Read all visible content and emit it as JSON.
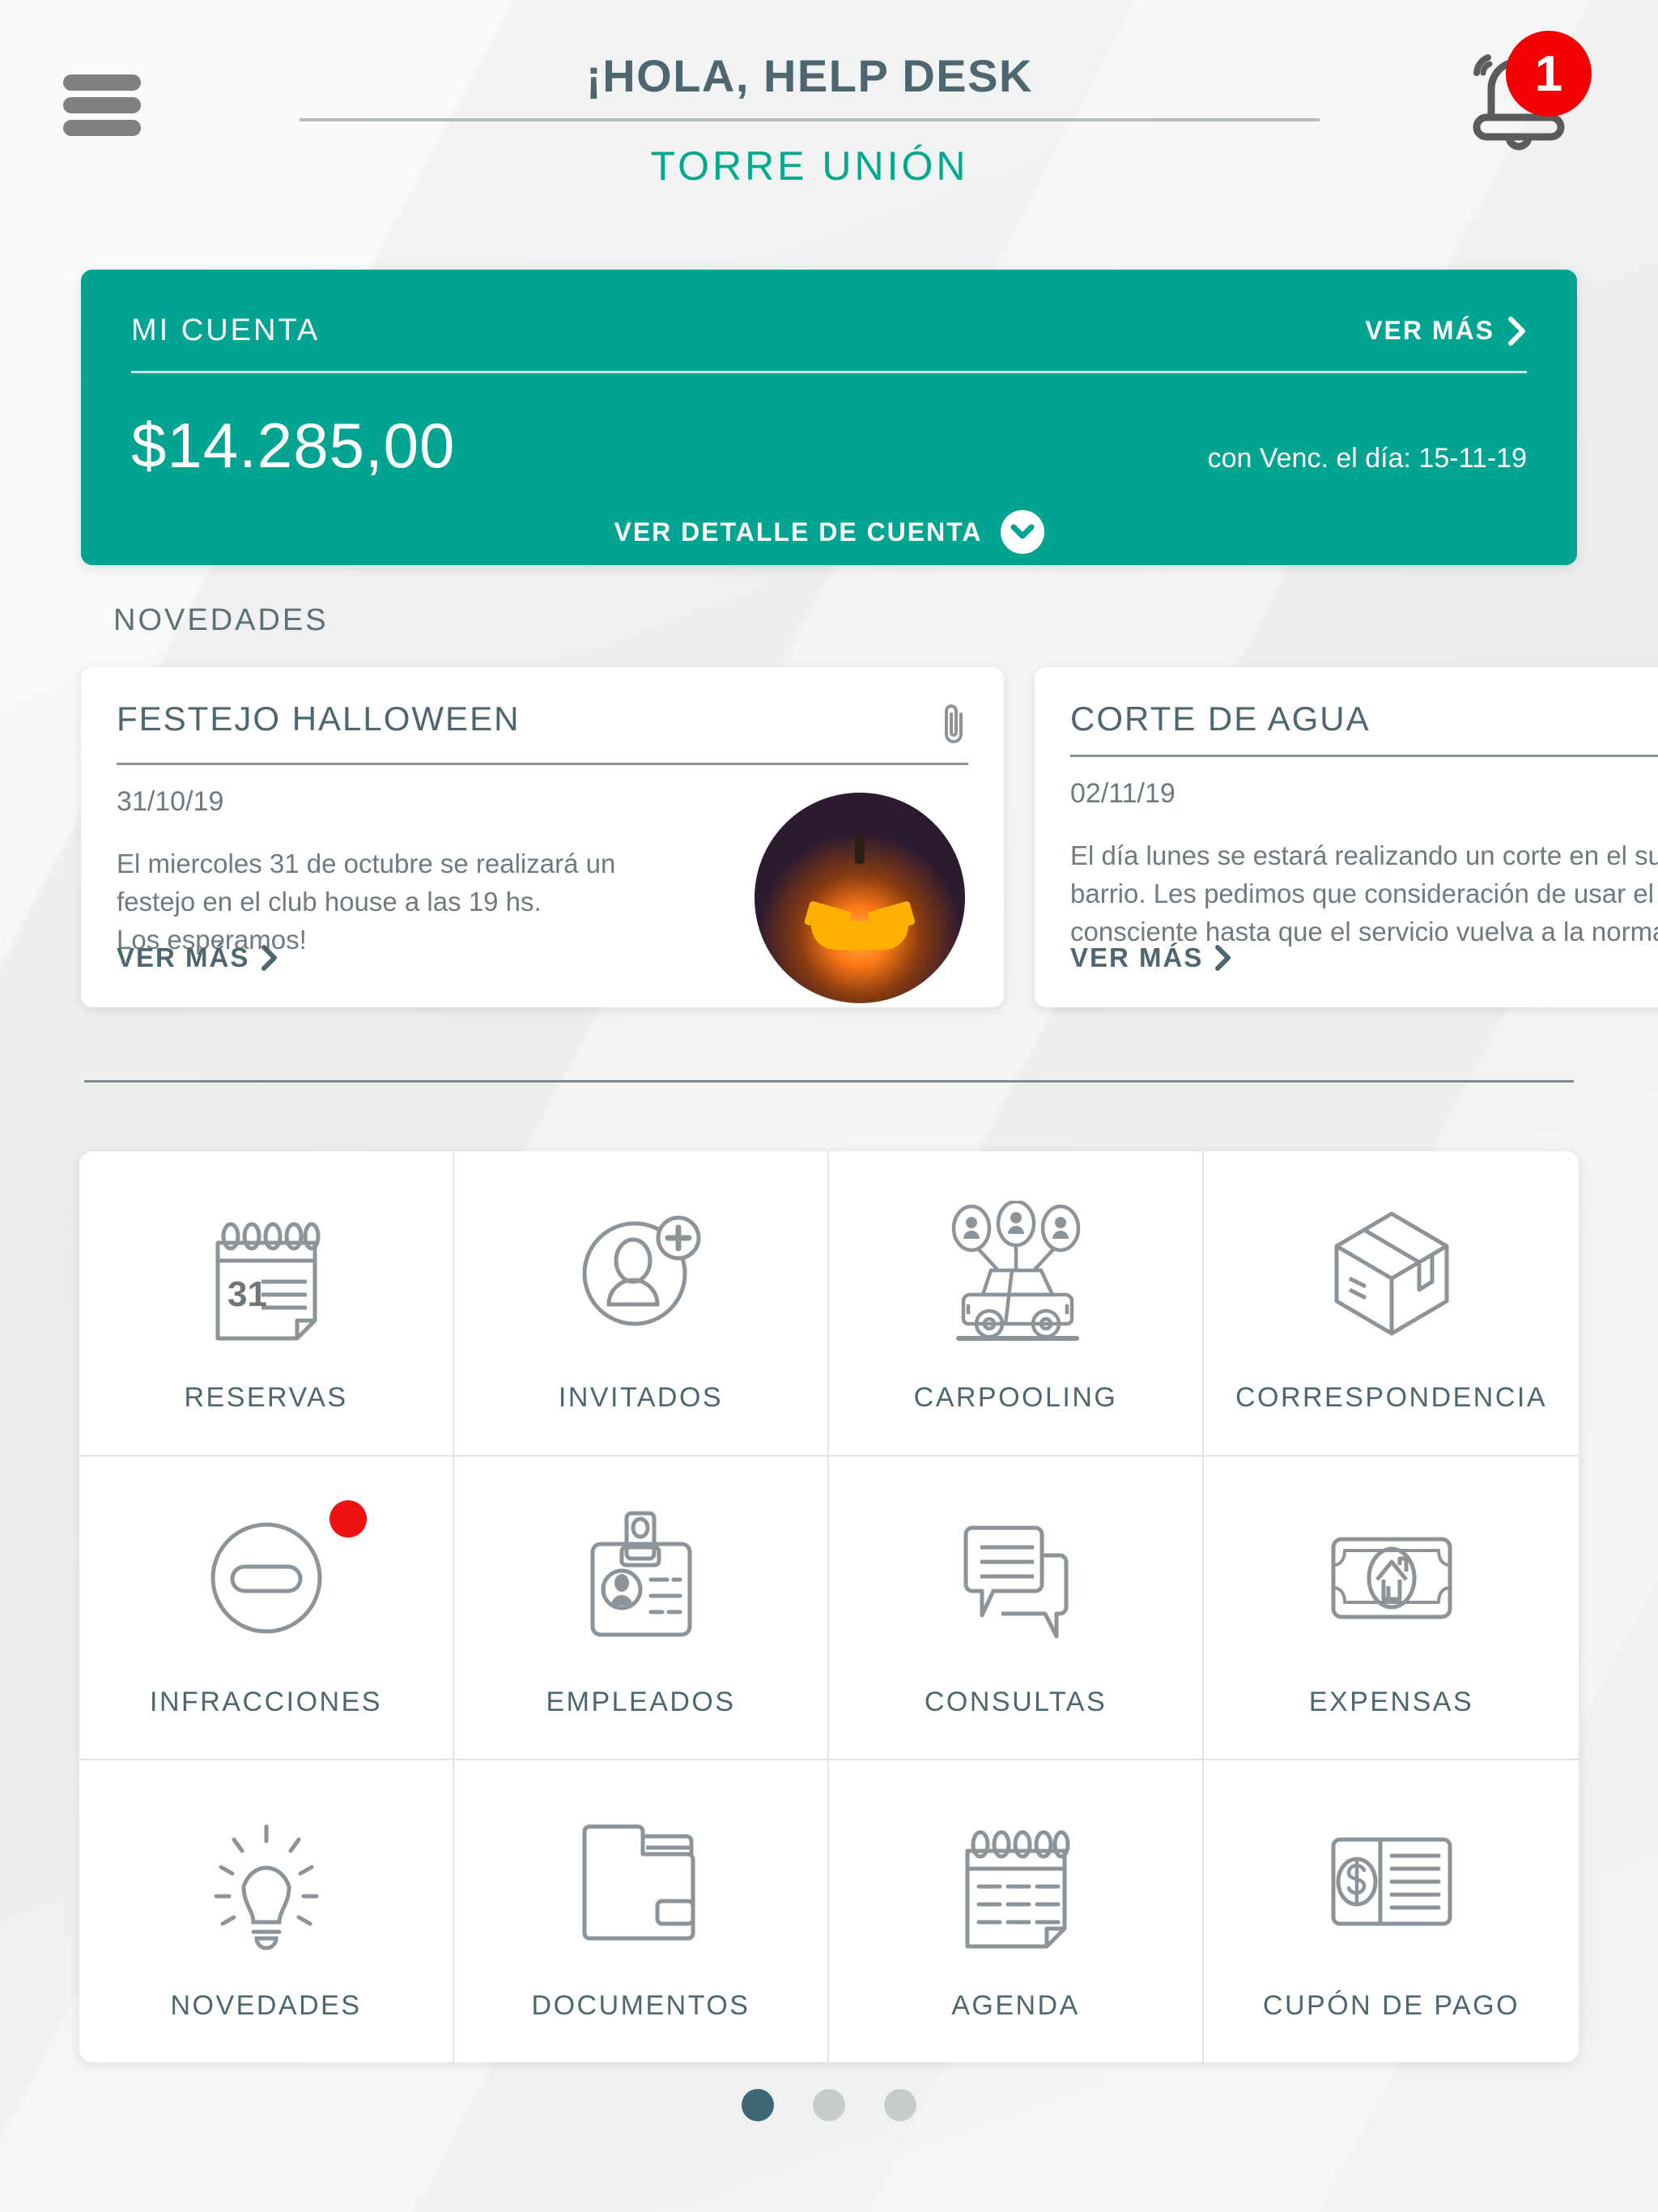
{
  "header": {
    "menu_icon": "hamburger-menu-icon",
    "title": "¡HOLA, HELP DESK",
    "subtitle": "TORRE UNIÓN",
    "notification": {
      "icon": "bell-icon",
      "count": "1",
      "badge_color": "#f40000"
    }
  },
  "account_card": {
    "label": "MI CUENTA",
    "see_more": "VER MÁS",
    "amount": "$14.285,00",
    "due": "con Venc. el día: 15-11-19",
    "detail_link": "VER DETALLE DE CUENTA",
    "chevron_icon": "chevron-down-icon",
    "bg_color": "#00a491"
  },
  "news": {
    "section_title": "NOVEDADES",
    "items": [
      {
        "title": "FESTEJO HALLOWEEN",
        "date": "31/10/19",
        "body": "El miercoles 31 de octubre se realizará un festejo en el club house a las 19 hs.\nLos esperamos!",
        "see_more": "VER MÁS",
        "attachment_icon": "paperclip-icon",
        "has_thumbnail": true
      },
      {
        "title": "CORTE DE AGUA",
        "date": "02/11/19",
        "body": "El día lunes se estará realizando un corte en el suministro de agua del barrio. Les pedimos que consideración de usar el agua de forma consciente hasta que el servicio vuelva a la normalidad.",
        "see_more": "VER MÁS",
        "attachment_icon": null,
        "has_thumbnail": false
      }
    ]
  },
  "menu_grid": {
    "items": [
      {
        "label": "RESERVAS",
        "icon": "calendar-31-icon",
        "badge": false
      },
      {
        "label": "INVITADOS",
        "icon": "user-plus-icon",
        "badge": false
      },
      {
        "label": "CARPOOLING",
        "icon": "carpool-car-icon",
        "badge": false
      },
      {
        "label": "CORRESPONDENCIA",
        "icon": "package-box-icon",
        "badge": false
      },
      {
        "label": "INFRACCIONES",
        "icon": "no-entry-icon",
        "badge": true
      },
      {
        "label": "EMPLEADOS",
        "icon": "id-badge-icon",
        "badge": false
      },
      {
        "label": "CONSULTAS",
        "icon": "chat-bubbles-icon",
        "badge": false
      },
      {
        "label": "EXPENSAS",
        "icon": "banknote-house-icon",
        "badge": false
      },
      {
        "label": "NOVEDADES",
        "icon": "lightbulb-icon",
        "badge": false
      },
      {
        "label": "DOCUMENTOS",
        "icon": "folder-icon",
        "badge": false
      },
      {
        "label": "AGENDA",
        "icon": "calendar-grid-icon",
        "badge": false
      },
      {
        "label": "CUPÓN DE PAGO",
        "icon": "payment-coupon-icon",
        "badge": false
      }
    ]
  },
  "pagination": {
    "total": 3,
    "active_index": 0,
    "active_color": "#3d6676",
    "inactive_color": "#c7cbcb"
  },
  "theme": {
    "accent_teal": "#00a491",
    "title_slate": "#4e6670",
    "subtitle_green": "#00a98c",
    "icon_gray": "#8d9499",
    "page_bg": "#f0f1f1"
  }
}
